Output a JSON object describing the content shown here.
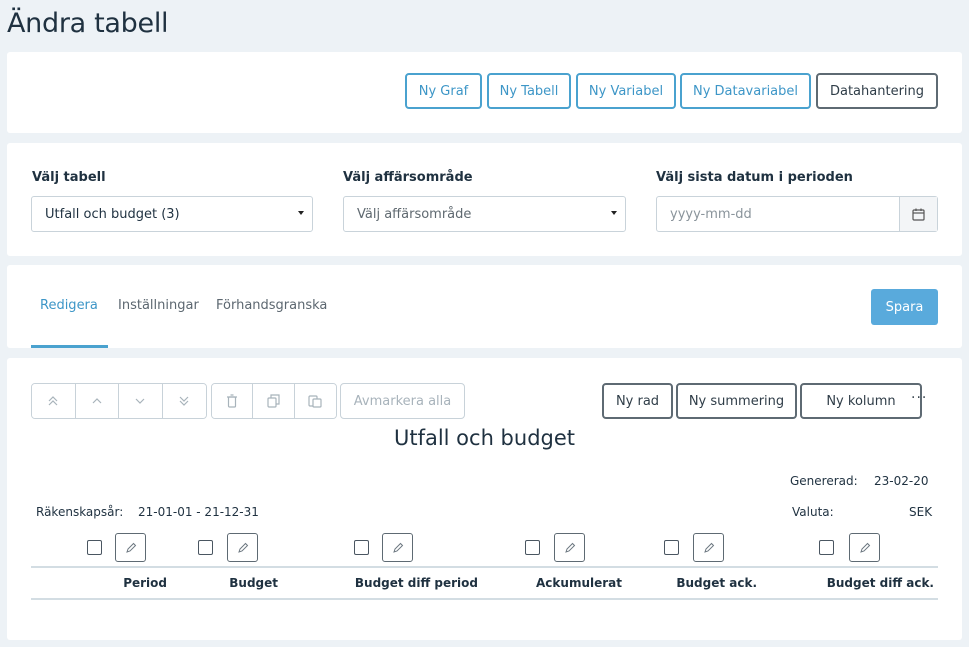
{
  "page": {
    "title": "Ändra tabell"
  },
  "toolbar": {
    "buttons": [
      "Ny Graf",
      "Ny Tabell",
      "Ny Variabel",
      "Ny Datavariabel",
      "Datahantering"
    ]
  },
  "selects": {
    "table_label": "Välj tabell",
    "table_value": "Utfall och budget (3)",
    "area_label": "Välj affärsområde",
    "area_placeholder": "Välj affärsområde",
    "date_label": "Välj sista datum i perioden",
    "date_placeholder": "yyyy-mm-dd"
  },
  "tabs": {
    "items": [
      "Redigera",
      "Inställningar",
      "Förhandsgranska"
    ],
    "active": "Redigera",
    "save_label": "Spara"
  },
  "editor": {
    "deselect_label": "Avmarkera alla",
    "new_row_label": "Ny rad",
    "new_sum_label": "Ny summering",
    "new_col_label": "Ny kolumn",
    "more_label": "···",
    "icons": [
      "move-top-icon",
      "move-up-icon",
      "move-down-icon",
      "move-bottom-icon",
      "trash-icon",
      "copy-icon",
      "paste-icon"
    ]
  },
  "table": {
    "title": "Utfall och budget",
    "generated_label": "Genererad:",
    "generated_value": "23-02-20",
    "fiscal_year_label": "Räkenskapsår:",
    "fiscal_year_value": "21-01-01 - 21-12-31",
    "currency_label": "Valuta:",
    "currency_value": "SEK",
    "columns": [
      "Period",
      "Budget",
      "Budget diff period",
      "Ackumulerat",
      "Budget ack.",
      "Budget diff ack."
    ]
  },
  "colors": {
    "accent": "#4aa2cf",
    "primary_button": "#59aadc",
    "background": "#edf2f6",
    "text": "#1f3140"
  }
}
